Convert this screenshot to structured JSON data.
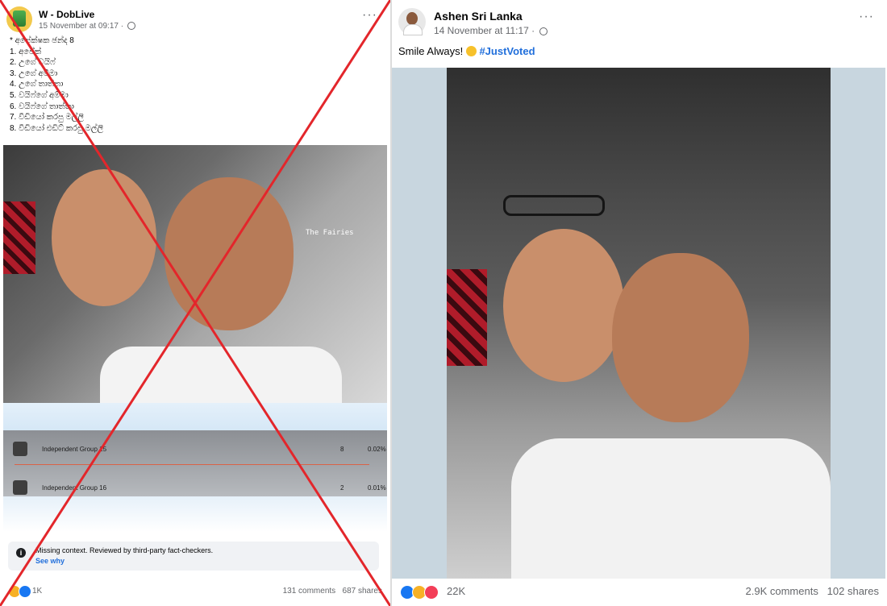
{
  "left_post": {
    "author": "W - DobLive",
    "timestamp": "15 November at 09:17 ·",
    "lines": [
      "* අපේක්ෂක ඡන්ද 8",
      "1. අපේක්",
      "2. උගේ වයිෆ්",
      "3. උගේ අම්මා",
      "4. උගේ තාත්තා",
      "5. වයිෆ්ගේ අම්මා",
      "6. වයිෆ්ගේ තාත්තා",
      "7. වීඩියෝ කරපු මල්ලි",
      "8. වීඩියෝ එඩිට් කරපු මල්ලි"
    ],
    "photo_watermark": "The Fairies",
    "results": [
      {
        "name": "Independent Group 15",
        "votes": "8",
        "pct": "0.02%"
      },
      {
        "name": "Independent Group 16",
        "votes": "2",
        "pct": "0.01%"
      }
    ],
    "factcheck_text": "Missing context. Reviewed by third-party fact-checkers.",
    "factcheck_link": "See why",
    "reactions_count": "1K",
    "comments": "131 comments",
    "shares": "687 shares"
  },
  "right_post": {
    "author": "Ashen Sri Lanka",
    "timestamp": "14 November at 11:17 ·",
    "caption_text": "Smile Always!",
    "caption_tag": "#JustVoted",
    "reactions_count": "22K",
    "comments": "2.9K comments",
    "shares": "102 shares"
  },
  "icons": [
    "globe-icon",
    "more-options-icon",
    "info-icon",
    "like-reaction-icon",
    "haha-reaction-icon",
    "love-reaction-icon"
  ],
  "colors": {
    "link": "#216fdb",
    "cross": "#e3262b",
    "like": "#1877f2",
    "love": "#f33e58",
    "haha": "#f7b125"
  }
}
